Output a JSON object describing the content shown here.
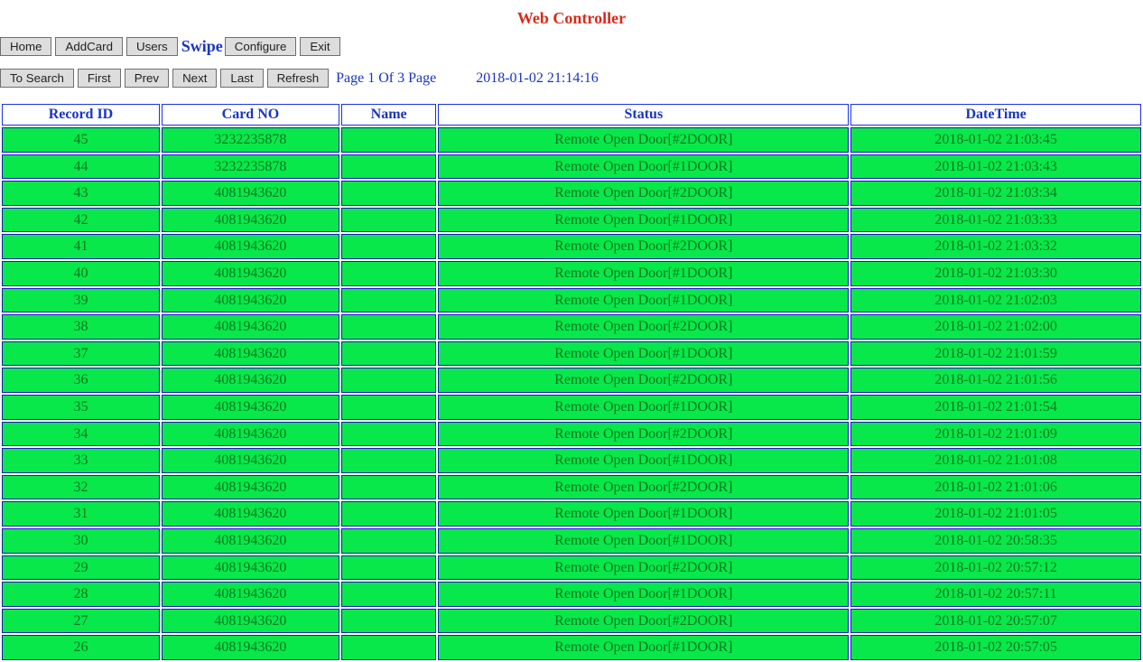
{
  "title": "Web Controller",
  "nav": {
    "home": "Home",
    "addcard": "AddCard",
    "users": "Users",
    "swipe": "Swipe",
    "configure": "Configure",
    "exit": "Exit"
  },
  "pager": {
    "tosearch": "To Search",
    "first": "First",
    "prev": "Prev",
    "next": "Next",
    "last": "Last",
    "refresh": "Refresh",
    "status": "Page 1 Of 3 Page",
    "clock": "2018-01-02 21:14:16"
  },
  "columns": {
    "record_id": "Record ID",
    "card_no": "Card NO",
    "name": "Name",
    "status": "Status",
    "datetime": "DateTime"
  },
  "rows": [
    {
      "id": "45",
      "card": "3232235878",
      "name": "",
      "status": "Remote Open Door[#2DOOR]",
      "dt": "2018-01-02 21:03:45"
    },
    {
      "id": "44",
      "card": "3232235878",
      "name": "",
      "status": "Remote Open Door[#1DOOR]",
      "dt": "2018-01-02 21:03:43"
    },
    {
      "id": "43",
      "card": "4081943620",
      "name": "",
      "status": "Remote Open Door[#2DOOR]",
      "dt": "2018-01-02 21:03:34"
    },
    {
      "id": "42",
      "card": "4081943620",
      "name": "",
      "status": "Remote Open Door[#1DOOR]",
      "dt": "2018-01-02 21:03:33"
    },
    {
      "id": "41",
      "card": "4081943620",
      "name": "",
      "status": "Remote Open Door[#2DOOR]",
      "dt": "2018-01-02 21:03:32"
    },
    {
      "id": "40",
      "card": "4081943620",
      "name": "",
      "status": "Remote Open Door[#1DOOR]",
      "dt": "2018-01-02 21:03:30"
    },
    {
      "id": "39",
      "card": "4081943620",
      "name": "",
      "status": "Remote Open Door[#1DOOR]",
      "dt": "2018-01-02 21:02:03"
    },
    {
      "id": "38",
      "card": "4081943620",
      "name": "",
      "status": "Remote Open Door[#2DOOR]",
      "dt": "2018-01-02 21:02:00"
    },
    {
      "id": "37",
      "card": "4081943620",
      "name": "",
      "status": "Remote Open Door[#1DOOR]",
      "dt": "2018-01-02 21:01:59"
    },
    {
      "id": "36",
      "card": "4081943620",
      "name": "",
      "status": "Remote Open Door[#2DOOR]",
      "dt": "2018-01-02 21:01:56"
    },
    {
      "id": "35",
      "card": "4081943620",
      "name": "",
      "status": "Remote Open Door[#1DOOR]",
      "dt": "2018-01-02 21:01:54"
    },
    {
      "id": "34",
      "card": "4081943620",
      "name": "",
      "status": "Remote Open Door[#2DOOR]",
      "dt": "2018-01-02 21:01:09"
    },
    {
      "id": "33",
      "card": "4081943620",
      "name": "",
      "status": "Remote Open Door[#1DOOR]",
      "dt": "2018-01-02 21:01:08"
    },
    {
      "id": "32",
      "card": "4081943620",
      "name": "",
      "status": "Remote Open Door[#2DOOR]",
      "dt": "2018-01-02 21:01:06"
    },
    {
      "id": "31",
      "card": "4081943620",
      "name": "",
      "status": "Remote Open Door[#1DOOR]",
      "dt": "2018-01-02 21:01:05"
    },
    {
      "id": "30",
      "card": "4081943620",
      "name": "",
      "status": "Remote Open Door[#1DOOR]",
      "dt": "2018-01-02 20:58:35"
    },
    {
      "id": "29",
      "card": "4081943620",
      "name": "",
      "status": "Remote Open Door[#2DOOR]",
      "dt": "2018-01-02 20:57:12"
    },
    {
      "id": "28",
      "card": "4081943620",
      "name": "",
      "status": "Remote Open Door[#1DOOR]",
      "dt": "2018-01-02 20:57:11"
    },
    {
      "id": "27",
      "card": "4081943620",
      "name": "",
      "status": "Remote Open Door[#2DOOR]",
      "dt": "2018-01-02 20:57:07"
    },
    {
      "id": "26",
      "card": "4081943620",
      "name": "",
      "status": "Remote Open Door[#1DOOR]",
      "dt": "2018-01-02 20:57:05"
    }
  ]
}
